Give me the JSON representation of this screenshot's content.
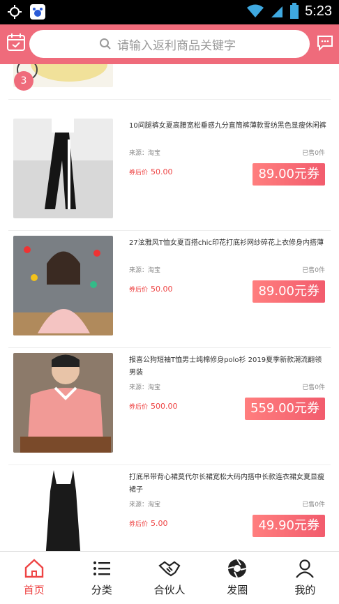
{
  "status_bar": {
    "time": "5:23"
  },
  "header": {
    "search_placeholder": "请输入返利商品关键字"
  },
  "top_partial": {
    "badge": "3"
  },
  "products": [
    {
      "title": "10间腿裤女夏高腰宽松垂感九分直筒裤薄款雪纺黑色显瘦休闲裤",
      "source": "来源：淘宝",
      "sold": "已售0件",
      "price_label": "券后价",
      "price": "50.00",
      "coupon": "89.00元券"
    },
    {
      "title": "27泫雅风T恤女夏百搭chic印花打底衫网纱碎花上衣修身内搭薄",
      "source": "来源：淘宝",
      "sold": "已售0件",
      "price_label": "券后价",
      "price": "50.00",
      "coupon": "89.00元券"
    },
    {
      "title": "报喜公狗短袖T恤男士纯棉修身polo衫 2019夏季新款潮流翻领男装",
      "source": "来源：淘宝",
      "sold": "已售0件",
      "price_label": "券后价",
      "price": "500.00",
      "coupon": "559.00元券"
    },
    {
      "title": "打底吊带背心裙莫代尔长裙宽松大码内搭中长款连衣裙女夏显瘦裙子",
      "source": "来源：淘宝",
      "sold": "已售0件",
      "price_label": "券后价",
      "price": "5.00",
      "coupon": "49.90元券"
    }
  ],
  "tabs": [
    {
      "label": "首页",
      "icon": "home-icon",
      "active": true
    },
    {
      "label": "分类",
      "icon": "list-icon"
    },
    {
      "label": "合伙人",
      "icon": "handshake-icon"
    },
    {
      "label": "发圈",
      "icon": "aperture-icon"
    },
    {
      "label": "我的",
      "icon": "user-icon"
    }
  ],
  "colors": {
    "accent": "#ef6b7b",
    "price": "#e44444"
  }
}
